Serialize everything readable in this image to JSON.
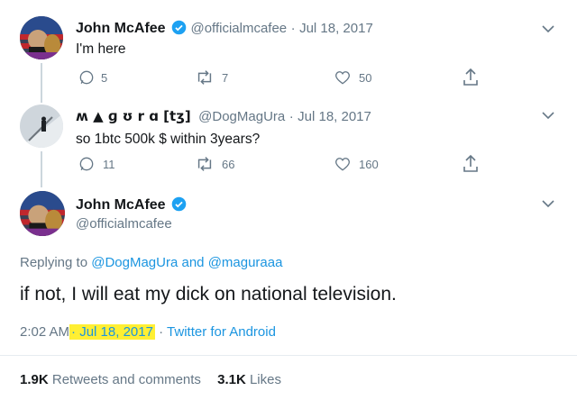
{
  "tweet1": {
    "name": "John McAfee",
    "handle": "@officialmcafee",
    "sep": "·",
    "date": "Jul 18, 2017",
    "text": "I'm here",
    "replies": "5",
    "retweets": "7",
    "likes": "50"
  },
  "tweet2": {
    "name": "ʍ ▲ ɡ ʊ r ɑ [tʒ]",
    "handle": "@DogMagUra",
    "sep": "·",
    "date": "Jul 18, 2017",
    "text": "so 1btc 500k $ within 3years?",
    "replies": "11",
    "retweets": "66",
    "likes": "160"
  },
  "tweet3": {
    "name": "John McAfee",
    "handle": "@officialmcafee",
    "replying_prefix": "Replying to",
    "replying_user1": "@DogMagUra",
    "replying_and": "and",
    "replying_user2": "@maguraaa",
    "text": "if not, I will eat my dick on national television.",
    "time": "2:02 AM",
    "sep1": "·",
    "date": "Jul 18, 2017",
    "sep2": "·",
    "source": "Twitter for Android",
    "retweets_value": "1.9K",
    "retweets_label": "Retweets and comments",
    "likes_value": "3.1K",
    "likes_label": "Likes"
  },
  "colors": {
    "verified": "#1da1f2",
    "link": "#1b95e0",
    "muted": "#657786",
    "highlight": "#ffef33"
  },
  "icons": [
    "verified-badge-icon",
    "chevron-down-icon",
    "reply-icon",
    "retweet-icon",
    "like-icon",
    "share-icon"
  ]
}
